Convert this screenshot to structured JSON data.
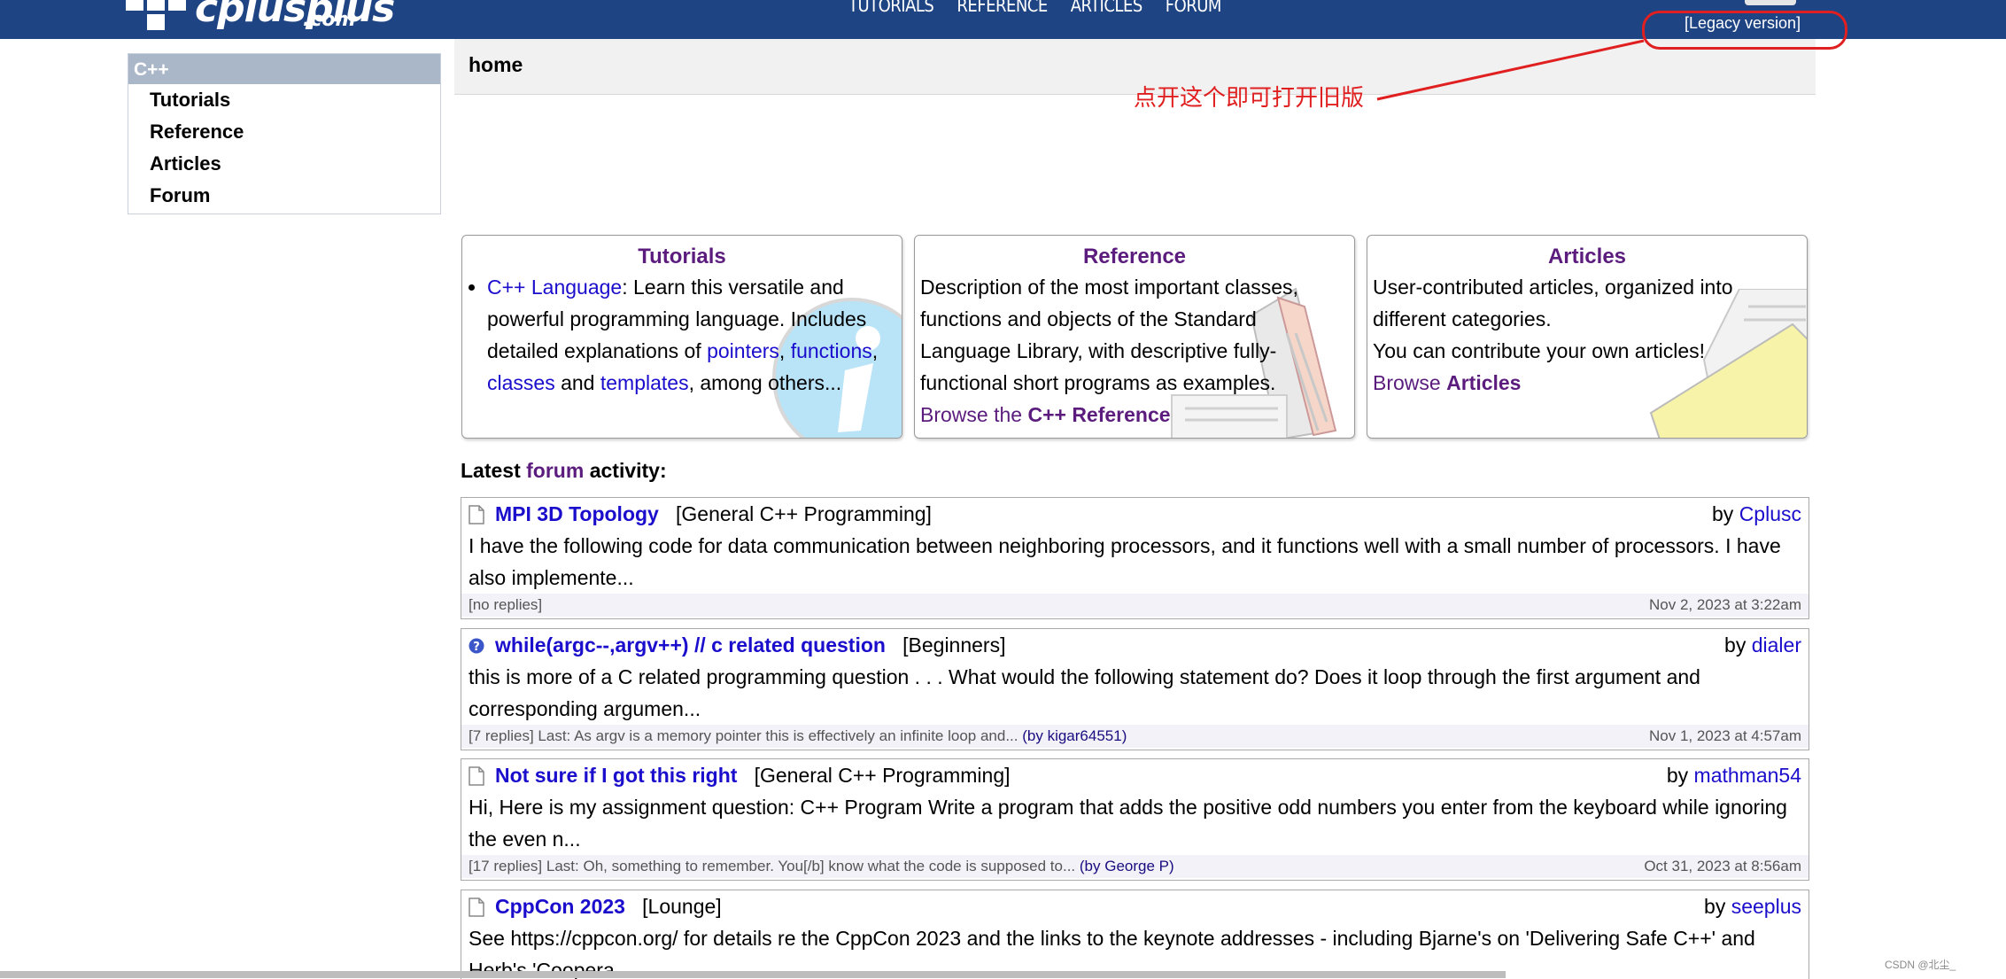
{
  "header": {
    "logo_word": "cplusplus",
    "logo_domain": ".com",
    "nav": [
      "TUTORIALS",
      "REFERENCE",
      "ARTICLES",
      "FORUM"
    ],
    "legacy": "[Legacy version]"
  },
  "sidebar": {
    "title": "C++",
    "items": [
      "Tutorials",
      "Reference",
      "Articles",
      "Forum"
    ]
  },
  "page": {
    "title": "home"
  },
  "annotation": {
    "text": "点开这个即可打开旧版",
    "color": "#e02020"
  },
  "boxes": {
    "tutorials": {
      "title": "Tutorials",
      "link_cpp": "C++ Language",
      "text1": ": Learn this versatile and powerful programming language. Includes detailed explanations of ",
      "link_pointers": "pointers",
      "comma1": ", ",
      "link_functions": "functions",
      "comma2": ", ",
      "link_classes": "classes",
      "and": " and ",
      "link_templates": "templates",
      "tail": ", among others..."
    },
    "reference": {
      "title": "Reference",
      "text": "Description of the most important classes, functions and objects of the Standard Language Library, with descriptive fully-functional short programs as examples.",
      "browse": "Browse the ",
      "browse_bold": "C++ Reference"
    },
    "articles": {
      "title": "Articles",
      "text1": "User-contributed articles, organized into different categories.",
      "text2": "You can contribute your own articles!",
      "browse": "Browse ",
      "browse_bold": "Articles"
    }
  },
  "forum": {
    "latest_prefix": "Latest ",
    "latest_link": "forum",
    "latest_suffix": " activity:",
    "posts": [
      {
        "icon": "document-icon",
        "title": "MPI 3D Topology",
        "category": "[General C++ Programming]",
        "by": "by ",
        "author": "Cplusc",
        "body": "I have the following code for data communication between neighboring processors, and it functions well with a small number of processors. I have also implemente...",
        "replies": "[no replies]",
        "last_label": "",
        "last_link": "",
        "last_by": "",
        "date": "Nov 2, 2023 at 3:22am"
      },
      {
        "icon": "question-icon",
        "title": "while(argc--,argv++) // c related question",
        "category": "[Beginners]",
        "by": "by ",
        "author": "dialer",
        "body": "this is more of a C related programming question . . . What would the following statement do? Does it loop through the first argument and corresponding argumen...",
        "replies": "[7 replies]",
        "last_label": " Last: ",
        "last_link": "As argv is a memory pointer this is effectively an infinite loop and...",
        "last_by": " (by kigar64551)",
        "date": "Nov 1, 2023 at 4:57am"
      },
      {
        "icon": "document-icon",
        "title": "Not sure if I got this right",
        "category": "[General C++ Programming]",
        "by": "by ",
        "author": "mathman54",
        "body": "Hi, Here is my assignment question: C++ Program Write a program that adds the positive odd numbers you enter from the keyboard while ignoring the even n...",
        "replies": "[17 replies]",
        "last_label": " Last: ",
        "last_link": "Oh, something to remember. You[/b] know what the code is supposed to...",
        "last_by": " (by George P)",
        "date": "Oct 31, 2023 at 8:56am"
      },
      {
        "icon": "document-icon",
        "title": "CppCon 2023",
        "category": "[Lounge]",
        "by": "by ",
        "author": "seeplus",
        "body": "See https://cppcon.org/ for details re the CppCon 2023 and the links to the keynote addresses - including Bjarne's on 'Delivering Safe C++' and Herb's 'Coopera...",
        "replies": "",
        "last_label": "",
        "last_link": "",
        "last_by": "",
        "date": ""
      }
    ]
  },
  "watermark": "CSDN @北尘_"
}
